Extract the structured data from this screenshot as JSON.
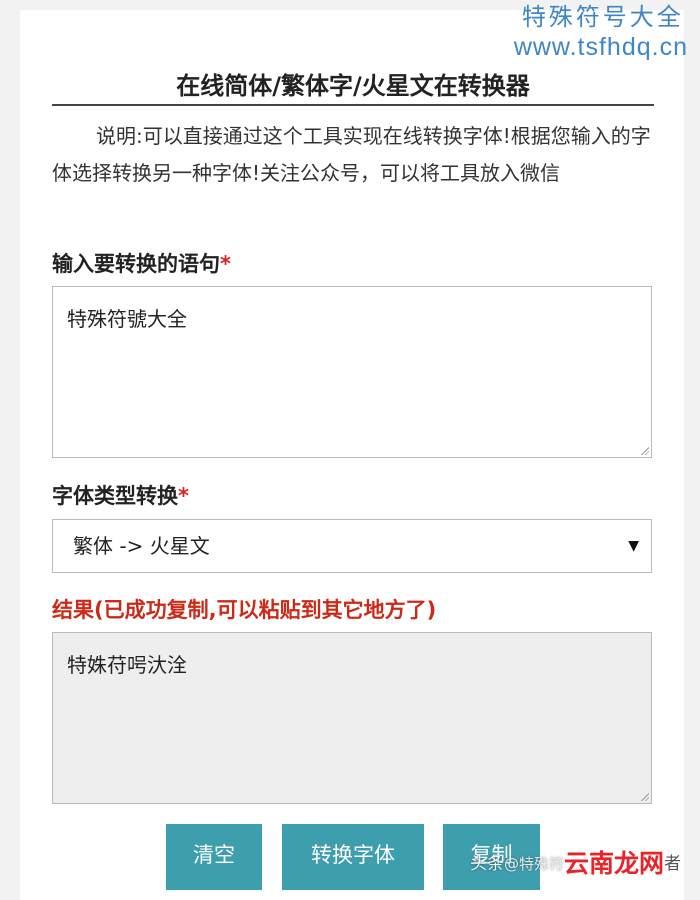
{
  "watermark": {
    "title": "特殊符号大全",
    "url": "www.tsfhdq.cn"
  },
  "page": {
    "title": "在线简体/繁体字/火星文在转换器",
    "description": "说明:可以直接通过这个工具实现在线转换字体!根据您输入的字体选择转换另一种字体!关注公众号，可以将工具放入微信"
  },
  "input": {
    "label": "输入要转换的语句",
    "required_mark": "*",
    "value": "特殊符號大全"
  },
  "font_type": {
    "label": "字体类型转换",
    "required_mark": "*",
    "selected": "繁体 -> 火星文",
    "arrow_icon": "▼"
  },
  "result": {
    "label": "结果(已成功复制,可以粘贴到其它地方了)",
    "value": "特姝苻呺汏洤"
  },
  "buttons": {
    "clear": "清空",
    "convert": "转换字体",
    "copy": "复制"
  },
  "footer_watermark": {
    "part1": "头条",
    "part2": "@特殊符",
    "logo": "云南龙网",
    "part3": "者"
  },
  "colors": {
    "button": "#3d9eae",
    "result_label": "#cc2a18",
    "watermark_blue": "#3f86c6"
  }
}
